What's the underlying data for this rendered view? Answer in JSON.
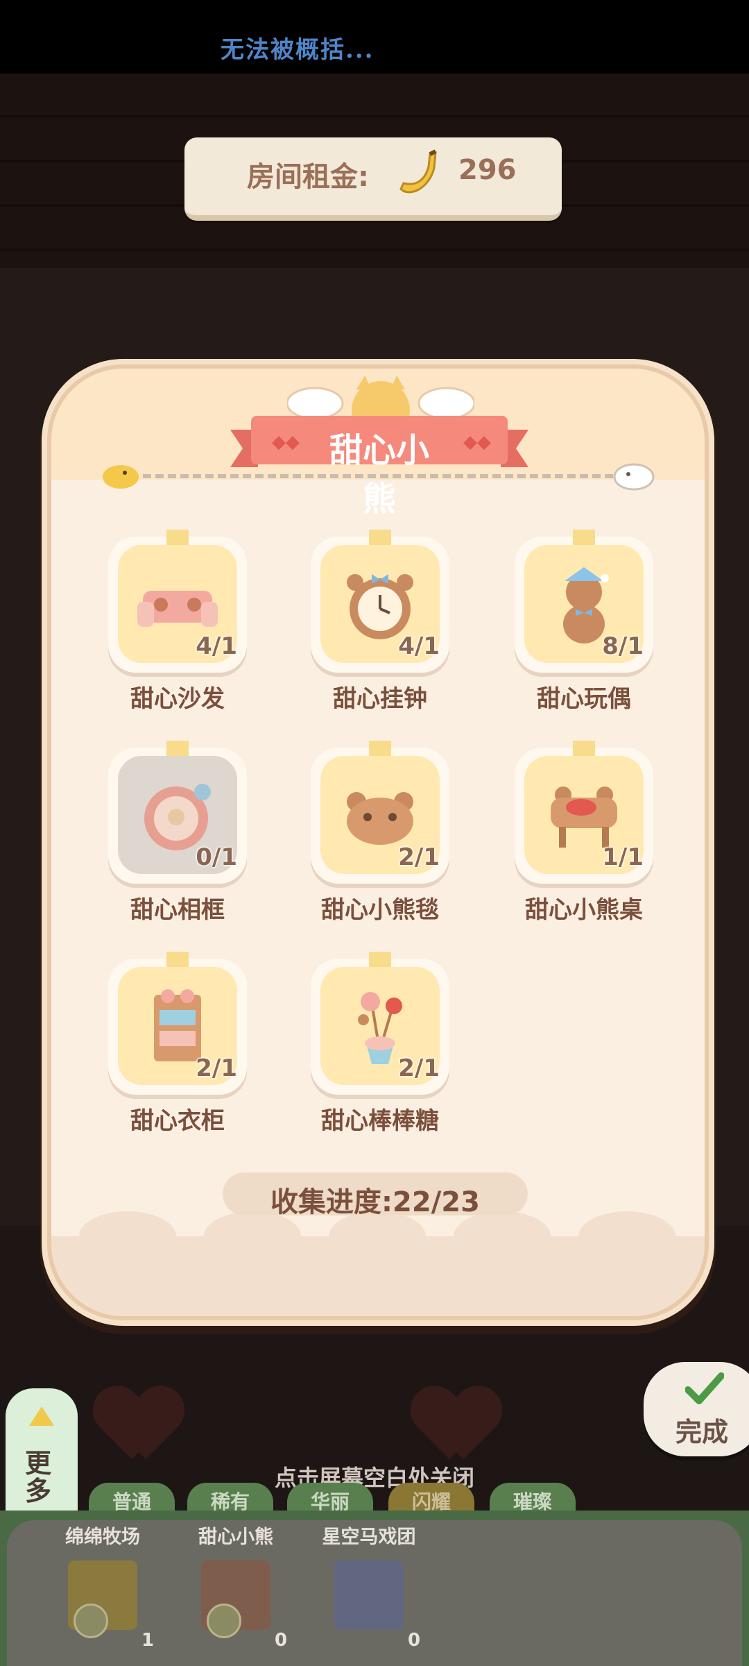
{
  "status_bar": {
    "text": "无法被概括..."
  },
  "rent": {
    "label": "房间租金:",
    "value": "296",
    "icon": "banana-icon"
  },
  "modal": {
    "title": "甜心小熊",
    "items": [
      {
        "name": "甜心沙发",
        "count": "4/1",
        "icon": "sofa-icon"
      },
      {
        "name": "甜心挂钟",
        "count": "4/1",
        "icon": "clock-icon"
      },
      {
        "name": "甜心玩偶",
        "count": "8/1",
        "icon": "teddy-bear-icon"
      },
      {
        "name": "甜心相框",
        "count": "0/1",
        "icon": "photo-frame-icon"
      },
      {
        "name": "甜心小熊毯",
        "count": "2/1",
        "icon": "bear-rug-icon"
      },
      {
        "name": "甜心小熊桌",
        "count": "1/1",
        "icon": "bear-table-icon"
      },
      {
        "name": "甜心衣柜",
        "count": "2/1",
        "icon": "wardrobe-icon"
      },
      {
        "name": "甜心棒棒糖",
        "count": "2/1",
        "icon": "lollipop-icon"
      }
    ],
    "progress": "收集进度:22/23"
  },
  "done_button": {
    "label": "完成"
  },
  "more_button": {
    "label": "更多"
  },
  "close_hint": "点击屏幕空白处关闭",
  "tabs": [
    {
      "label": "普通"
    },
    {
      "label": "稀有"
    },
    {
      "label": "华丽"
    },
    {
      "label": "闪耀"
    },
    {
      "label": "璀璨"
    }
  ],
  "sets": [
    {
      "name": "绵绵牧场",
      "count": "1"
    },
    {
      "name": "甜心小熊",
      "count": "0"
    },
    {
      "name": "星空马戏团",
      "count": "0"
    }
  ],
  "colors": {
    "accent": "#f07d72",
    "card": "#ffe9b1",
    "text_brown": "#7a4f3c"
  }
}
